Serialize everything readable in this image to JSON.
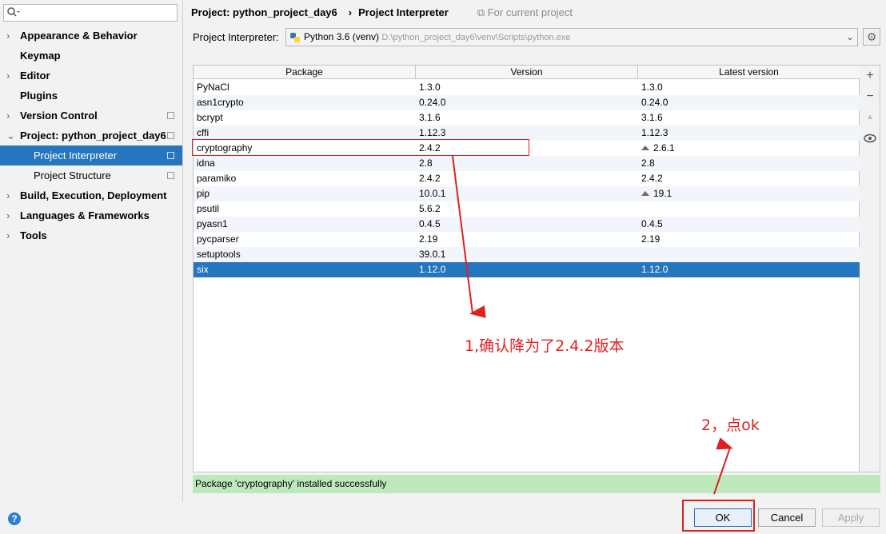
{
  "sidebar": {
    "search_placeholder": "",
    "items": [
      {
        "label": "Appearance & Behavior",
        "arrow": "›"
      },
      {
        "label": "Keymap",
        "arrow": ""
      },
      {
        "label": "Editor",
        "arrow": "›"
      },
      {
        "label": "Plugins",
        "arrow": ""
      },
      {
        "label": "Version Control",
        "arrow": "›"
      },
      {
        "label": "Project: python_project_day6",
        "arrow": "⌄"
      },
      {
        "label": "Project Interpreter",
        "arrow": ""
      },
      {
        "label": "Project Structure",
        "arrow": ""
      },
      {
        "label": "Build, Execution, Deployment",
        "arrow": "›"
      },
      {
        "label": "Languages & Frameworks",
        "arrow": "›"
      },
      {
        "label": "Tools",
        "arrow": "›"
      }
    ]
  },
  "header": {
    "project": "Project: python_project_day6",
    "separator": "›",
    "page": "Project Interpreter",
    "scope": "For current project"
  },
  "interpreter": {
    "label": "Project Interpreter:",
    "name": "Python 3.6 (venv)",
    "path": "D:\\python_project_day6\\venv\\Scripts\\python.exe"
  },
  "table": {
    "headers": [
      "Package",
      "Version",
      "Latest version"
    ],
    "rows": [
      {
        "package": "PyNaCl",
        "version": "1.3.0",
        "latest": "1.3.0",
        "upgrade": false
      },
      {
        "package": "asn1crypto",
        "version": "0.24.0",
        "latest": "0.24.0",
        "upgrade": false
      },
      {
        "package": "bcrypt",
        "version": "3.1.6",
        "latest": "3.1.6",
        "upgrade": false
      },
      {
        "package": "cffi",
        "version": "1.12.3",
        "latest": "1.12.3",
        "upgrade": false
      },
      {
        "package": "cryptography",
        "version": "2.4.2",
        "latest": "2.6.1",
        "upgrade": true
      },
      {
        "package": "idna",
        "version": "2.8",
        "latest": "2.8",
        "upgrade": false
      },
      {
        "package": "paramiko",
        "version": "2.4.2",
        "latest": "2.4.2",
        "upgrade": false
      },
      {
        "package": "pip",
        "version": "10.0.1",
        "latest": "19.1",
        "upgrade": true
      },
      {
        "package": "psutil",
        "version": "5.6.2",
        "latest": "",
        "upgrade": false
      },
      {
        "package": "pyasn1",
        "version": "0.4.5",
        "latest": "0.4.5",
        "upgrade": false
      },
      {
        "package": "pycparser",
        "version": "2.19",
        "latest": "2.19",
        "upgrade": false
      },
      {
        "package": "setuptools",
        "version": "39.0.1",
        "latest": "",
        "upgrade": false
      },
      {
        "package": "six",
        "version": "1.12.0",
        "latest": "1.12.0",
        "upgrade": false
      }
    ],
    "selected_row": 12
  },
  "side_toolbar": {
    "add": "+",
    "remove": "−",
    "upgrade": "▲",
    "show": "👁"
  },
  "status": "Package 'cryptography' installed successfully",
  "annotations": {
    "note1": "1,确认降为了2.4.2版本",
    "note2": "2，点ok"
  },
  "buttons": {
    "ok": "OK",
    "cancel": "Cancel",
    "apply": "Apply",
    "help": "?"
  },
  "colors": {
    "selection": "#2675bf",
    "annotation": "#e02020",
    "status_bg": "#bde9bd"
  }
}
